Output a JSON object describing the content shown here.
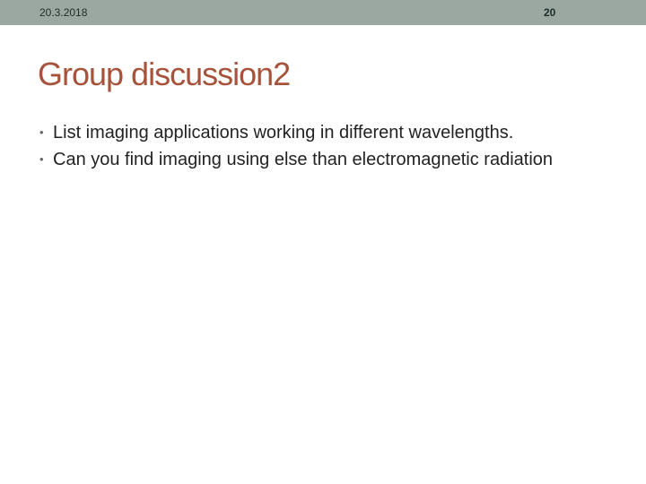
{
  "header": {
    "date": "20.3.2018",
    "page_number": "20",
    "bar_color": "#9aa8a1"
  },
  "slide": {
    "title": "Group discussion2",
    "title_color": "#a7523b",
    "bullets": [
      "List imaging applications working in different wavelengths.",
      "Can you find imaging using else than electromagnetic radiation"
    ]
  }
}
